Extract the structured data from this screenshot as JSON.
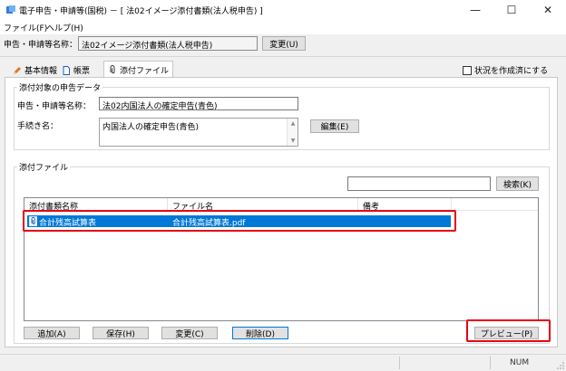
{
  "window": {
    "title": "電子申告・申請等(国税) － [ 法02イメージ添付書類(法人税申告) ]",
    "minimize_glyph": "—",
    "maximize_glyph": "☐",
    "close_glyph": "✕"
  },
  "menu": {
    "items": [
      "ファイル(F)",
      "ヘルプ(H)"
    ]
  },
  "topbar": {
    "label": "申告・申請等名称：",
    "value": "法02イメージ添付書類(法人税申告)",
    "change_button": "変更(U)"
  },
  "tabs": [
    {
      "label": "基本情報",
      "active": false
    },
    {
      "label": "帳票",
      "active": false
    },
    {
      "label": "添付ファイル",
      "active": true
    }
  ],
  "status_checkbox": {
    "label": "状況を作成済にする",
    "checked": false
  },
  "target_group": {
    "title": "添付対象の申告データ",
    "name_label": "申告・申請等名称：",
    "name_value": "法02内国法人の確定申告(青色)",
    "procedure_label": "手続き名：",
    "procedure_value": "内国法人の確定申告(青色)",
    "edit_button": "編集(E)"
  },
  "attach_group": {
    "title": "添付ファイル",
    "search_value": "",
    "search_button": "検索(K)",
    "columns": [
      "添付書類名称",
      "ファイル名",
      "備考"
    ],
    "rows": [
      {
        "name": "合計残高試算表",
        "file": "合計残高試算表.pdf",
        "note": "",
        "selected": true
      }
    ]
  },
  "buttons": {
    "add": "追加(A)",
    "save": "保存(H)",
    "change": "変更(C)",
    "delete": "削除(D)",
    "preview": "プレビュー(P)"
  },
  "statusbar": {
    "num": "NUM"
  },
  "colors": {
    "selection": "#0078d7",
    "highlight_box": "#e60012"
  }
}
